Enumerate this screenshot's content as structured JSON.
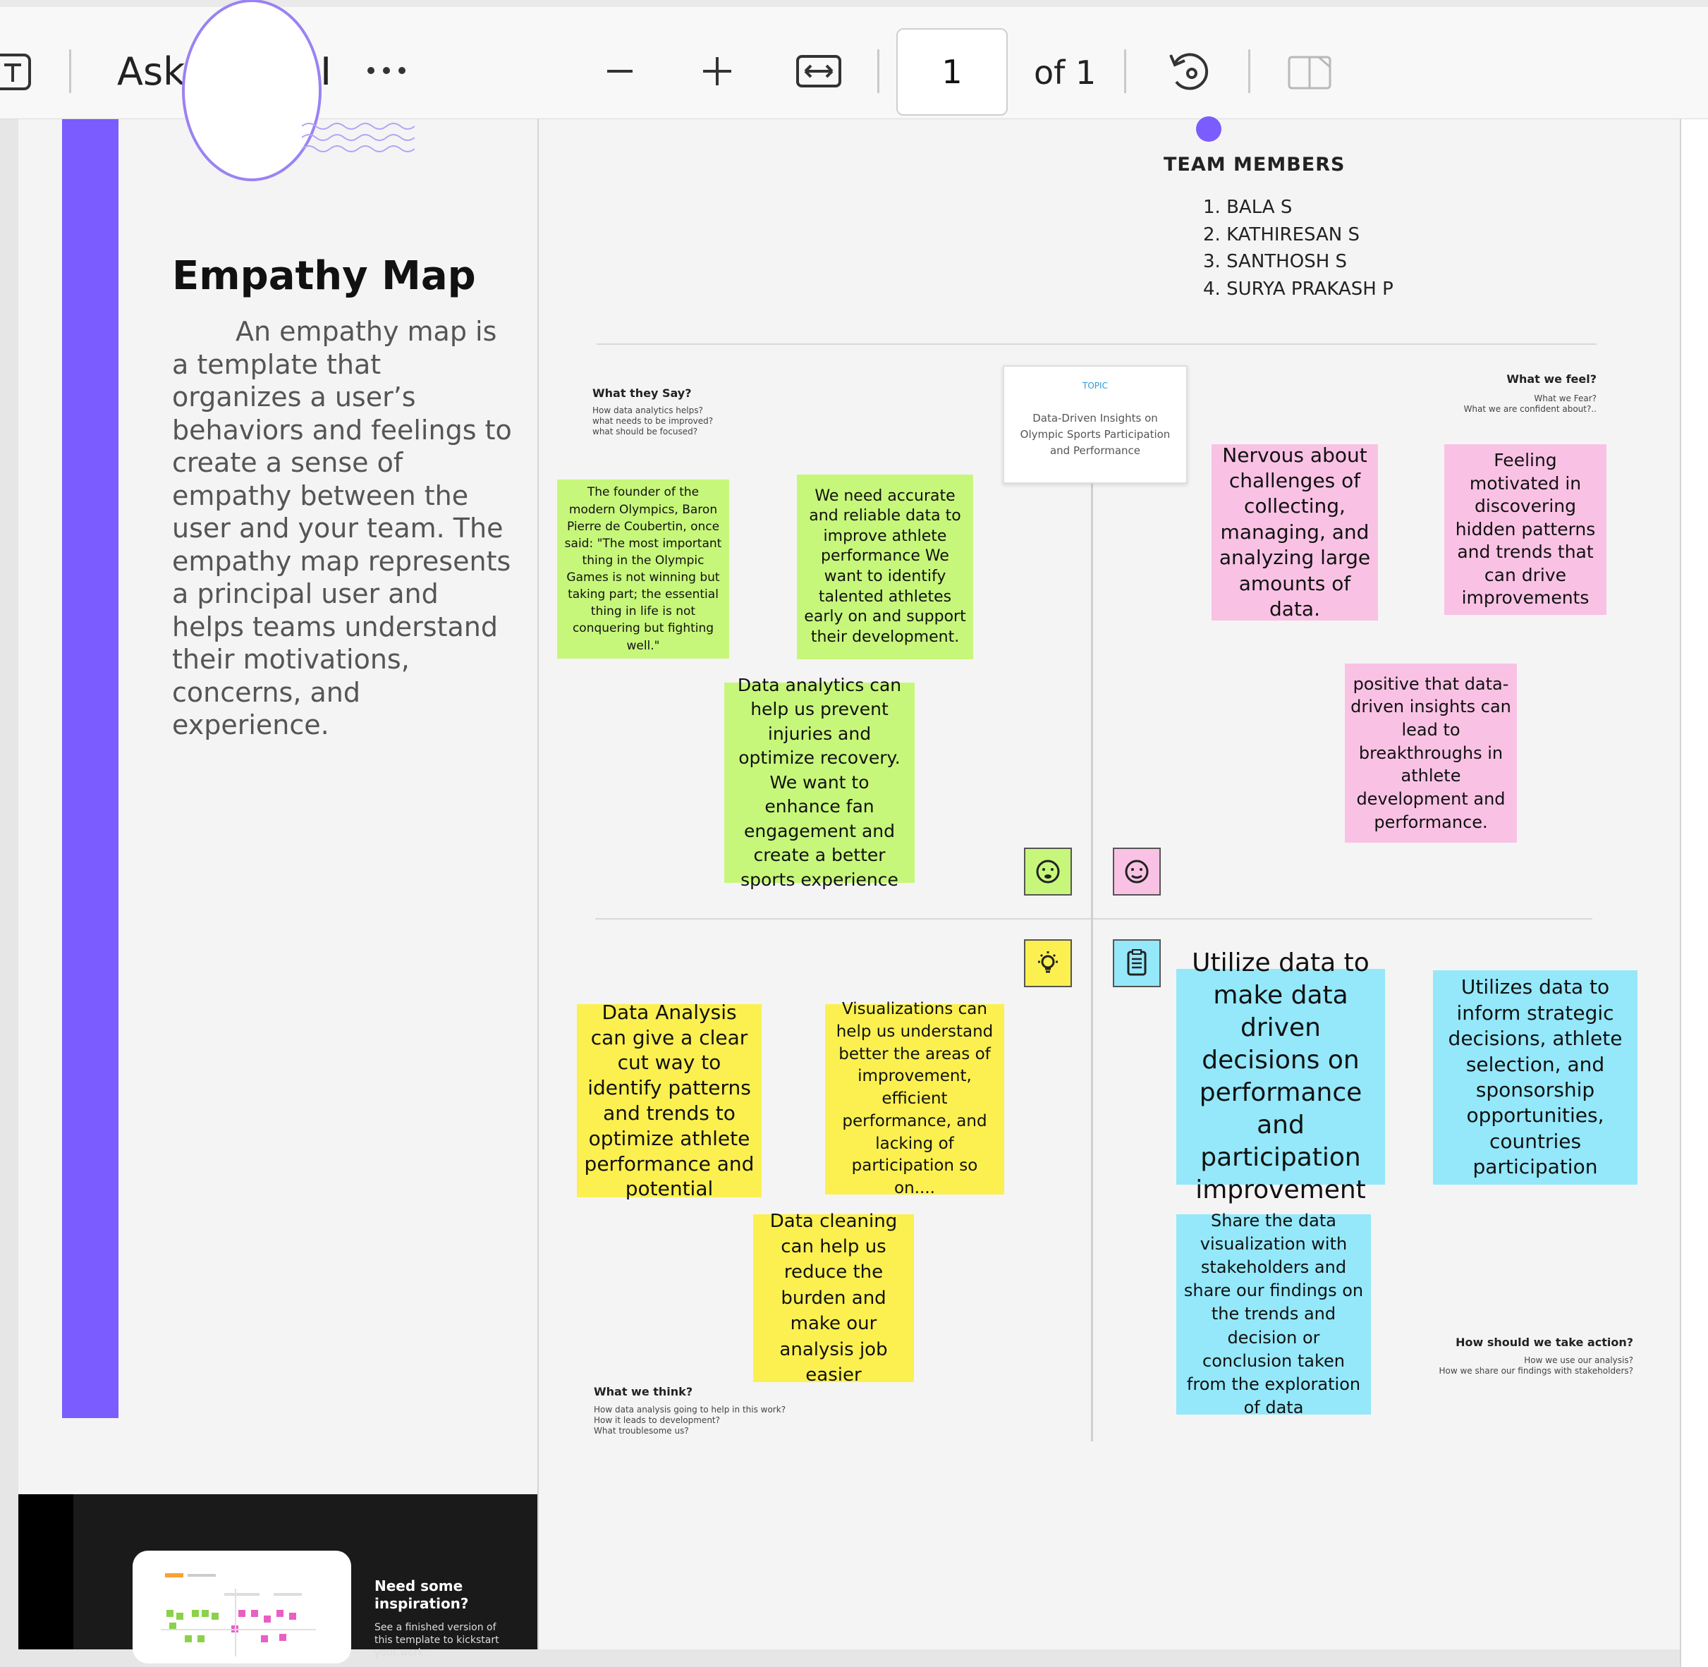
{
  "toolbar": {
    "text_icon": "text-select-icon",
    "ask_bing": "Ask Bing AI",
    "more": "···",
    "zoom_out": "zoom-out-icon",
    "zoom_in": "zoom-in-icon",
    "fit_width": "fit-width-icon",
    "page_current": "1",
    "page_total": "of 1",
    "rotate": "rotate-icon",
    "page_view": "page-view-icon"
  },
  "left_page": {
    "title": "Empathy Map",
    "description": "An empathy map is a template that organizes a user’s behaviors and feelings to create a sense of empathy between the user and your team. The empathy map represents a principal user and helps teams understand their motivations, concerns, and experience.",
    "inspiration_heading": "Need some inspiration?",
    "inspiration_sub": "See a finished version of this template to kickstart your work."
  },
  "team": {
    "title": "TEAM MEMBERS",
    "members": [
      "1. BALA S",
      "2. KATHIRESAN S",
      "3. SANTHOSH S",
      "4. SURYA PRAKASH P"
    ]
  },
  "topic": {
    "label": "TOPIC",
    "text": "Data-Driven Insights on Olympic Sports Participation and Performance"
  },
  "quadrants": {
    "say": {
      "heading": "What they Say?",
      "sub": [
        "How data analytics helps?",
        "what needs to be improved?",
        "what should be focused?"
      ]
    },
    "feel": {
      "heading": "What we feel?",
      "sub": [
        "What we Fear?",
        "What we are confident about?.."
      ]
    },
    "think": {
      "heading": "What we think?",
      "sub": [
        "How data analysis going to help in this work?",
        "How it leads to development?",
        "What troublesome us?"
      ]
    },
    "do": {
      "heading": "How should we take action?",
      "sub": [
        "How we use our analysis?",
        "How we share our findings with stakeholders?"
      ]
    }
  },
  "notes": {
    "say_1": "The founder of the modern Olympics, Baron Pierre de Coubertin, once said: \"The most important thing in the Olympic Games is not winning but taking part; the essential thing in life is not conquering but fighting well.\"",
    "say_2": "We need accurate and reliable data to improve athlete performance We want to identify talented athletes early on and support their development.",
    "say_3": "Data analytics can help us prevent injuries and optimize recovery. We want to enhance fan engagement and create a better sports experience",
    "feel_1": "Nervous about challenges of collecting, managing, and analyzing large amounts of data.",
    "feel_2": "Feeling motivated in discovering hidden patterns and trends that can drive improvements",
    "feel_3": "positive that data-driven insights can lead to breakthroughs in athlete development and performance.",
    "think_1": "Data Analysis can give a clear cut way to identify patterns and trends to optimize athlete performance and potential",
    "think_2": "Visualizations can help us understand better the areas of improvement, efficient performance, and lacking of participation so on....",
    "think_3": "Data cleaning can help us reduce the burden and make our analysis job easier",
    "do_1": "Utilize data to make data driven decisions on performance and participation improvement",
    "do_2": "Utilizes data to inform strategic decisions, athlete selection, and sponsorship opportunities, countries participation",
    "do_3": "Share the data visualization with stakeholders and share our findings on the trends and decision or conclusion taken from the exploration of data"
  },
  "icons": {
    "say": "speech-face-icon",
    "feel": "feeling-face-icon",
    "think": "lightbulb-icon",
    "do": "clipboard-icon"
  },
  "colors": {
    "accent": "#7b5cff",
    "green": "#c7f77a",
    "pink": "#f9c2e4",
    "yellow": "#fbf050",
    "blue": "#94e8fa"
  }
}
